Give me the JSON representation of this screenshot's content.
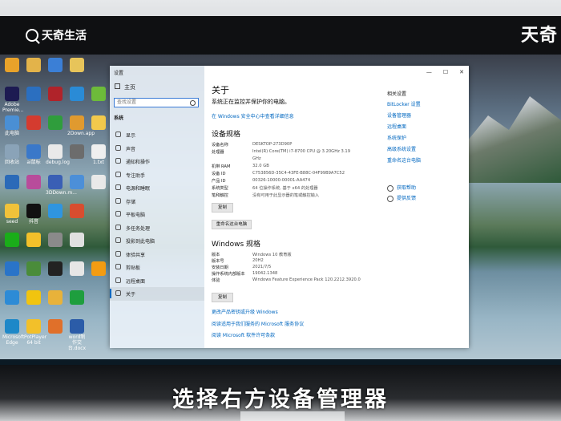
{
  "watermark": {
    "logo_text": "天奇生活",
    "corner_text": "天奇"
  },
  "subtitle": "选择右方设备管理器",
  "desktop_icons": [
    {
      "label": "",
      "color": "#e8a22a"
    },
    {
      "label": "",
      "color": "#e3b34a"
    },
    {
      "label": "",
      "color": "#3b7fd6"
    },
    {
      "label": "",
      "color": "#e7c45a"
    },
    {
      "label": "Adobe Premie...",
      "color": "#1d1b52"
    },
    {
      "label": "",
      "color": "#2b6fc0"
    },
    {
      "label": "",
      "color": "#b0232a"
    },
    {
      "label": "",
      "color": "#2a8bd6"
    },
    {
      "label": "",
      "color": "#6dbb3a"
    },
    {
      "label": "此电脑",
      "color": "#4a8fd4"
    },
    {
      "label": "",
      "color": "#d43b2f"
    },
    {
      "label": "",
      "color": "#2f9d3c"
    },
    {
      "label": "2Down.app",
      "color": "#e09a2f"
    },
    {
      "label": "",
      "color": "#f2c94c"
    },
    {
      "label": "回收站",
      "color": "#8aa3b8"
    },
    {
      "label": "ai鼠标",
      "color": "#3a78c9"
    },
    {
      "label": "debug.log",
      "color": "#e9e9e9"
    },
    {
      "label": "",
      "color": "#6c6c6c"
    },
    {
      "label": "1.txt",
      "color": "#efefef"
    },
    {
      "label": "",
      "color": "#2b6ab8"
    },
    {
      "label": "",
      "color": "#b84c9b"
    },
    {
      "label": "3DDown.m...",
      "color": "#3a5fb5"
    },
    {
      "label": "",
      "color": "#4c8fd8"
    },
    {
      "label": "",
      "color": "#e9e9e9"
    },
    {
      "label": "seed",
      "color": "#f0c23a"
    },
    {
      "label": "抖音",
      "color": "#111"
    },
    {
      "label": "",
      "color": "#2f95e0"
    },
    {
      "label": "",
      "color": "#d84d2f"
    },
    {
      "label": "",
      "color": "#1aad19"
    },
    {
      "label": "",
      "color": "#f2c02a"
    },
    {
      "label": "",
      "color": "#8a8a8a"
    },
    {
      "label": "",
      "color": "#e0e0e0"
    },
    {
      "label": "",
      "color": "#2a74c8"
    },
    {
      "label": "",
      "color": "#4a8c3a"
    },
    {
      "label": "",
      "color": "#222"
    },
    {
      "label": "",
      "color": "#e6e6e6"
    },
    {
      "label": "",
      "color": "#f39c12"
    },
    {
      "label": "",
      "color": "#2d8bd6"
    },
    {
      "label": "",
      "color": "#f1c40f"
    },
    {
      "label": "",
      "color": "#e8b23a"
    },
    {
      "label": "",
      "color": "#1e9e3e"
    },
    {
      "label": "Microsoft Edge",
      "color": "#1e88c8"
    },
    {
      "label": "PotPlayer 64 bit",
      "color": "#f2c02a"
    },
    {
      "label": "",
      "color": "#e0702a"
    },
    {
      "label": "word制作交台.docx",
      "color": "#2b5ca8"
    }
  ],
  "window": {
    "title": "设置",
    "nav": {
      "home": "主页",
      "search_placeholder": "查找设置",
      "section": "系统",
      "items": [
        {
          "label": "显示",
          "icon": "display-icon"
        },
        {
          "label": "声音",
          "icon": "sound-icon"
        },
        {
          "label": "通知和操作",
          "icon": "notification-icon"
        },
        {
          "label": "专注助手",
          "icon": "focus-assist-icon"
        },
        {
          "label": "电源和睡眠",
          "icon": "power-icon"
        },
        {
          "label": "存储",
          "icon": "storage-icon"
        },
        {
          "label": "平板电脑",
          "icon": "tablet-icon"
        },
        {
          "label": "多任务处理",
          "icon": "multitasking-icon"
        },
        {
          "label": "投影到此电脑",
          "icon": "projecting-icon"
        },
        {
          "label": "体验共享",
          "icon": "shared-experiences-icon"
        },
        {
          "label": "剪贴板",
          "icon": "clipboard-icon"
        },
        {
          "label": "远程桌面",
          "icon": "remote-desktop-icon"
        },
        {
          "label": "关于",
          "icon": "about-icon"
        }
      ]
    },
    "controls": {
      "minimize": "—",
      "maximize": "☐",
      "close": "✕"
    },
    "main": {
      "title": "关于",
      "status": "系统正在监控并保护你的电脑。",
      "security_link": "在 Windows 安全中心中查看详细信息",
      "device_specs": {
        "heading": "设备规格",
        "rows": [
          {
            "key": "设备名称",
            "value": "DESKTOP-273D90P"
          },
          {
            "key": "处理器",
            "value": "Intel(R) Core(TM) i7-8700 CPU @ 3.20GHz   3.19"
          },
          {
            "key": "",
            "value": "GHz"
          },
          {
            "key": "机带 RAM",
            "value": "32.0 GB"
          },
          {
            "key": "设备 ID",
            "value": "C753856D-35C4-43FE-B88C-04F99B9A7C52"
          },
          {
            "key": "产品 ID",
            "value": "00326-10000-00001-AA474"
          },
          {
            "key": "系统类型",
            "value": "64 位操作系统, 基于 x64 的处理器"
          },
          {
            "key": "笔和触控",
            "value": "没有可用于此显示器的笔或触控输入"
          }
        ],
        "copy_button": "复制",
        "rename_button": "重命名这台电脑"
      },
      "windows_specs": {
        "heading": "Windows 规格",
        "rows": [
          {
            "key": "版本",
            "value": "Windows 10 教育版"
          },
          {
            "key": "版本号",
            "value": "20H2"
          },
          {
            "key": "安装日期",
            "value": "2021/7/5"
          },
          {
            "key": "操作系统内部版本",
            "value": "19042.1348"
          },
          {
            "key": "体验",
            "value": "Windows Feature Experience Pack 120.2212.3920.0"
          }
        ],
        "copy_button": "复制"
      },
      "bottom_links": [
        "更改产品密钥或升级 Windows",
        "阅读适用于我们服务的 Microsoft 服务协议",
        "阅读 Microsoft 软件许可条款"
      ],
      "related": {
        "heading": "相关设置",
        "links": [
          "BitLocker 设置",
          "设备管理器",
          "远程桌面",
          "系统保护",
          "高级系统设置",
          "重命名这台电脑"
        ]
      },
      "help": [
        {
          "label": "获取帮助",
          "icon": "help-icon"
        },
        {
          "label": "提供反馈",
          "icon": "feedback-icon"
        }
      ]
    }
  }
}
